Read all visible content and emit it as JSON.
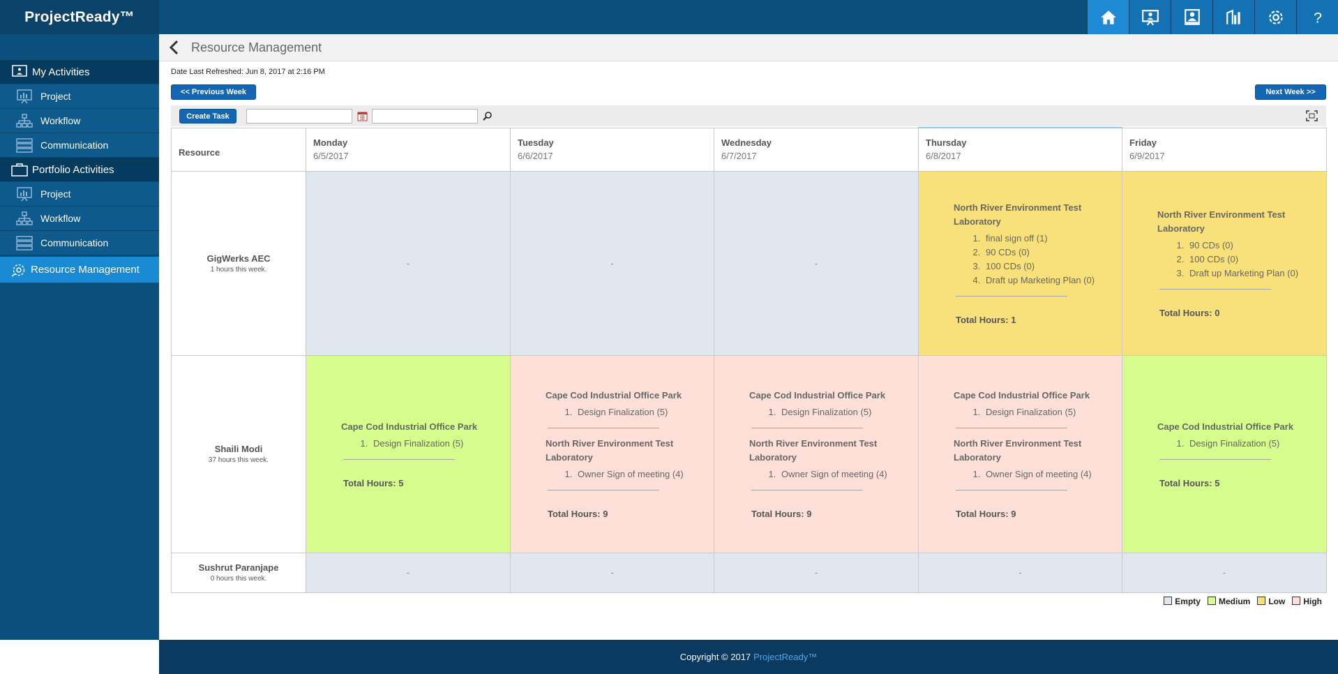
{
  "app": {
    "brand": "ProjectReady™"
  },
  "topnav": [
    "home-icon",
    "presentation-icon",
    "org-icon",
    "reports-icon",
    "gear-icon",
    "help-icon"
  ],
  "sidebar": {
    "my_activities": "My Activities",
    "my_items": [
      {
        "label": "Project"
      },
      {
        "label": "Workflow"
      },
      {
        "label": "Communication"
      }
    ],
    "portfolio_activities": "Portfolio Activities",
    "portfolio_items": [
      {
        "label": "Project"
      },
      {
        "label": "Workflow"
      },
      {
        "label": "Communication"
      }
    ],
    "active": "Resource Management"
  },
  "page": {
    "title": "Resource Management",
    "refreshed": "Date Last Refreshed: Jun 8, 2017 at 2:16 PM",
    "prev_week": "<< Previous Week",
    "next_week": "Next Week >>",
    "create_task": "Create Task",
    "date_input_value": "",
    "search_value": ""
  },
  "grid": {
    "resource_header": "Resource",
    "days": [
      {
        "day": "Monday",
        "date": "6/5/2017"
      },
      {
        "day": "Tuesday",
        "date": "6/6/2017"
      },
      {
        "day": "Wednesday",
        "date": "6/7/2017"
      },
      {
        "day": "Thursday",
        "date": "6/8/2017"
      },
      {
        "day": "Friday",
        "date": "6/9/2017"
      }
    ],
    "rows": [
      {
        "name": "GigWerks AEC",
        "hours": "1 hours this week.",
        "cells": [
          {
            "empty": "-"
          },
          {
            "empty": "-"
          },
          {
            "empty": "-"
          },
          {
            "projects": [
              {
                "name": "North River Environment Test Laboratory",
                "tasks": [
                  "final sign off (1)",
                  "90 CDs (0)",
                  "100 CDs (0)",
                  "Draft up Marketing Plan (0)"
                ]
              }
            ],
            "total": "Total Hours: 1"
          },
          {
            "projects": [
              {
                "name": "North River Environment Test Laboratory",
                "tasks": [
                  "90 CDs (0)",
                  "100 CDs (0)",
                  "Draft up Marketing Plan (0)"
                ]
              }
            ],
            "total": "Total Hours: 0"
          }
        ]
      },
      {
        "name": "Shaili Modi",
        "hours": "37 hours this week.",
        "cells": [
          {
            "projects": [
              {
                "name": "Cape Cod Industrial Office Park",
                "tasks": [
                  "Design Finalization (5)"
                ]
              }
            ],
            "total": "Total Hours: 5"
          },
          {
            "projects": [
              {
                "name": "Cape Cod Industrial Office Park",
                "tasks": [
                  "Design Finalization (5)"
                ]
              },
              {
                "name": "North River Environment Test Laboratory",
                "tasks": [
                  "Owner Sign of meeting (4)"
                ]
              }
            ],
            "total": "Total Hours: 9"
          },
          {
            "projects": [
              {
                "name": "Cape Cod Industrial Office Park",
                "tasks": [
                  "Design Finalization (5)"
                ]
              },
              {
                "name": "North River Environment Test Laboratory",
                "tasks": [
                  "Owner Sign of meeting (4)"
                ]
              }
            ],
            "total": "Total Hours: 9"
          },
          {
            "projects": [
              {
                "name": "Cape Cod Industrial Office Park",
                "tasks": [
                  "Design Finalization (5)"
                ]
              },
              {
                "name": "North River Environment Test Laboratory",
                "tasks": [
                  "Owner Sign of meeting (4)"
                ]
              }
            ],
            "total": "Total Hours: 9"
          },
          {
            "projects": [
              {
                "name": "Cape Cod Industrial Office Park",
                "tasks": [
                  "Design Finalization (5)"
                ]
              }
            ],
            "total": "Total Hours: 5"
          }
        ]
      },
      {
        "name": "Sushrut Paranjape",
        "hours": "0 hours this week.",
        "cells": [
          {
            "empty": "-"
          },
          {
            "empty": "-"
          },
          {
            "empty": "-"
          },
          {
            "empty": "-"
          },
          {
            "empty": "-"
          }
        ]
      }
    ]
  },
  "legend": [
    {
      "label": "Empty",
      "color": "#e1e7ef"
    },
    {
      "label": "Medium",
      "color": "#d7fc8e"
    },
    {
      "label": "Low",
      "color": "#f8e07a"
    },
    {
      "label": "High",
      "color": "#ffe0d8"
    }
  ],
  "footer": {
    "copyright": "Copyright © 2017",
    "link": "ProjectReady™"
  }
}
